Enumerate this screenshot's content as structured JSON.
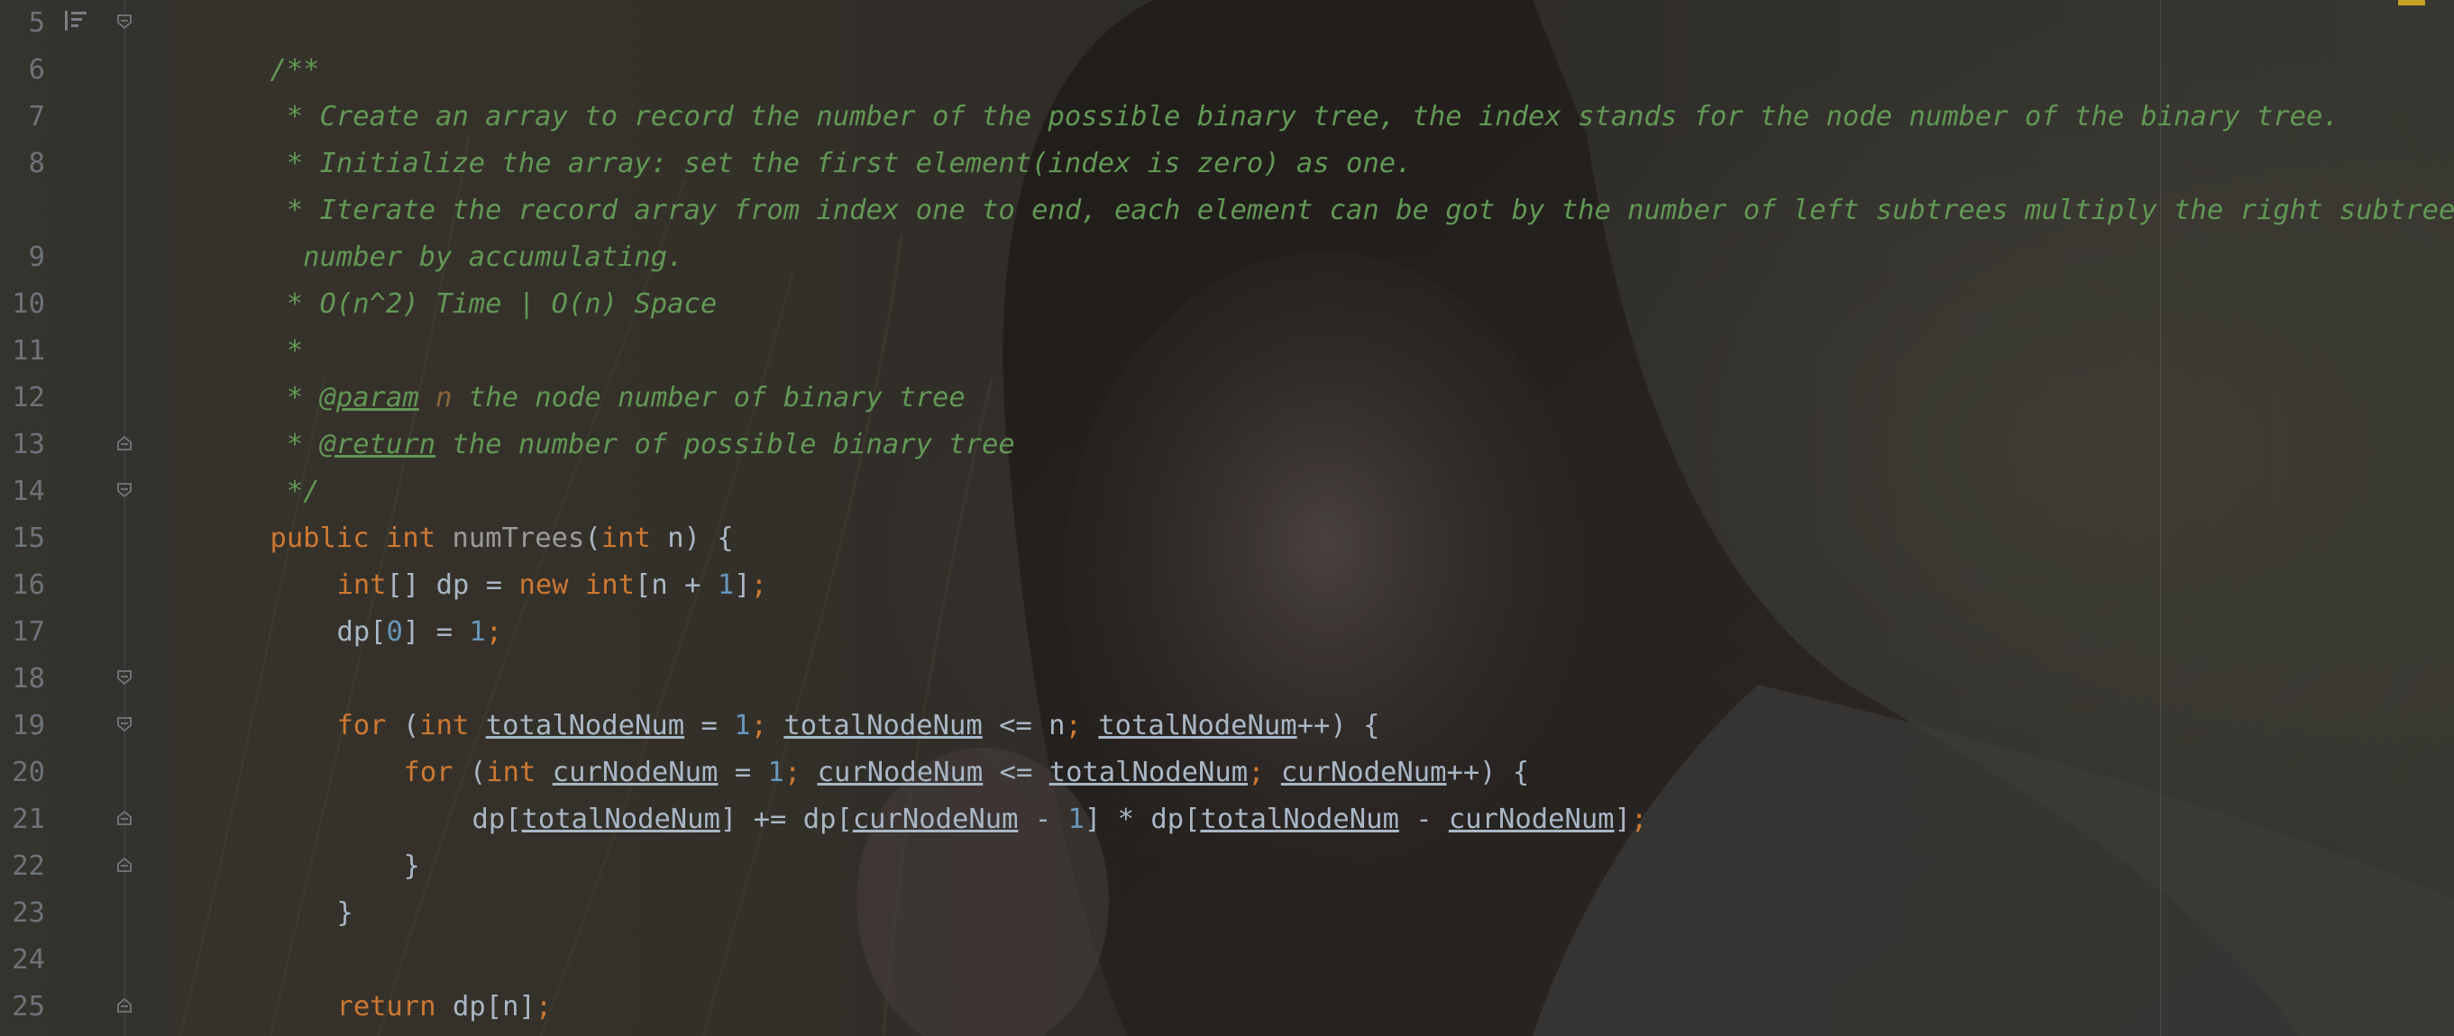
{
  "editor": {
    "theme_colors": {
      "background": "#2b2b2b",
      "keyword": "#cc7832",
      "number": "#6897bb",
      "comment": "#629755",
      "text": "#a9b7c6",
      "line_number": "#6e7378"
    }
  },
  "gutter": {
    "line_numbers": [
      "5",
      "6",
      "7",
      "8",
      "",
      "9",
      "10",
      "11",
      "12",
      "13",
      "14",
      "15",
      "16",
      "17",
      "18",
      "19",
      "20",
      "21",
      "22",
      "23",
      "24",
      "25"
    ]
  },
  "code": {
    "l5": {
      "t1": "/**"
    },
    "l6": {
      "t1": " * Create an array to record the number of the possible binary tree, the index stands for the node number of the binary tree."
    },
    "l7": {
      "t1": " * Initialize the array: set the first element(index is zero) as one."
    },
    "l8": {
      "t1": " * Iterate the record array from index one to end, each element can be got by the number of left subtrees multiply the right subtree"
    },
    "l8b": {
      "t1": "  number by accumulating."
    },
    "l9": {
      "t1": " * O(n^2) Time | O(n) Space"
    },
    "l10": {
      "t1": " *"
    },
    "l11": {
      "t1": " * ",
      "tag": "@param",
      "sp": " ",
      "prm": "n",
      "t2": " the node number of binary tree"
    },
    "l12": {
      "t1": " * ",
      "tag": "@return",
      "t2": " the number of possible binary tree"
    },
    "l13": {
      "t1": " */"
    },
    "l14": {
      "kw1": "public",
      "sp1": " ",
      "kw2": "int",
      "sp2": " ",
      "fn": "numTrees",
      "p1": "(",
      "kw3": "int",
      "t1": " n) {"
    },
    "l15": {
      "kw1": "int",
      "t1": "[] dp = ",
      "kw2": "new",
      "sp": " ",
      "kw3": "int",
      "t2": "[n + ",
      "n1": "1",
      "t3": "]",
      "s1": ";"
    },
    "l16": {
      "t1": "dp[",
      "n1": "0",
      "t2": "] = ",
      "n2": "1",
      "s1": ";"
    },
    "l18": {
      "kw1": "for",
      "t1": " (",
      "kw2": "int",
      "sp": " ",
      "v1": "totalNodeNum",
      "t2": " = ",
      "n1": "1",
      "s1": ";",
      "sp2": " ",
      "v2": "totalNodeNum",
      "t3": " <= n",
      "s2": ";",
      "sp3": " ",
      "v3": "totalNodeNum",
      "t4": "++) {"
    },
    "l19": {
      "kw1": "for",
      "t1": " (",
      "kw2": "int",
      "sp": " ",
      "v1": "curNodeNum",
      "t2": " = ",
      "n1": "1",
      "s1": ";",
      "sp2": " ",
      "v2": "curNodeNum",
      "t3": " <= ",
      "v3": "totalNodeNum",
      "s2": ";",
      "sp3": " ",
      "v4": "curNodeNum",
      "t4": "++) {"
    },
    "l20": {
      "t1": "dp[",
      "v1": "totalNodeNum",
      "t2": "] += dp[",
      "v2": "curNodeNum",
      "t3": " - ",
      "n1": "1",
      "t4": "] * dp[",
      "v3": "totalNodeNum",
      "t5": " - ",
      "v4": "curNodeNum",
      "t6": "]",
      "s1": ";"
    },
    "l21": {
      "t1": "}"
    },
    "l22": {
      "t1": "}"
    },
    "l24": {
      "kw1": "return",
      "t1": " dp[n]",
      "s1": ";"
    },
    "l25": {
      "t1": "}"
    }
  }
}
